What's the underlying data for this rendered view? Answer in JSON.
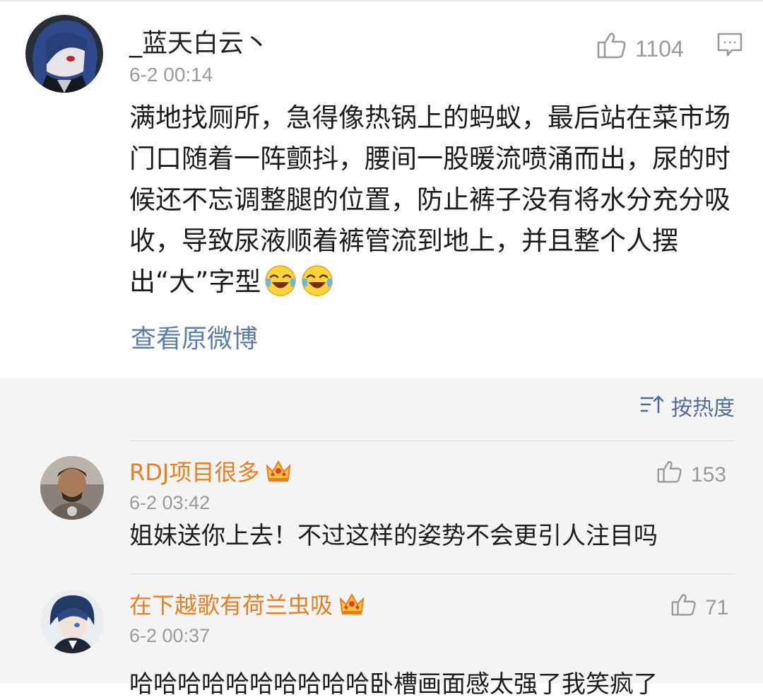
{
  "main_post": {
    "username": "_蓝天白云丶",
    "time": "6-2 00:14",
    "like_count": "1104",
    "like_icon": "thumbs-up-icon",
    "comment_icon": "comment-bubble-icon",
    "text": "满地找厕所，急得像热锅上的蚂蚁，最后站在菜市场门口随着一阵颤抖，腰间一股暖流喷涌而出，尿的时候还不忘调整腿的位置，防止裤子没有将水分充分吸收，导致尿液顺着裤管流到地上，并且整个人摆出“大”字型",
    "emojis": [
      "laughing-crying-emoji",
      "laughing-crying-emoji"
    ],
    "view_original_label": "查看原微博"
  },
  "sort": {
    "icon": "sort-icon",
    "label": "按热度"
  },
  "comments": [
    {
      "username": "RDJ项目很多",
      "badge": "crown-icon",
      "time": "6-2 03:42",
      "like_count": "153",
      "text": "姐妹送你上去！不过这样的姿势不会更引人注目吗"
    },
    {
      "username": "在下越歌有荷兰虫吸",
      "badge": "crown-icon",
      "time": "6-2 00:37",
      "like_count": "71",
      "text": "哈哈哈哈哈哈哈哈哈哈卧槽画面感太强了我笑疯了"
    }
  ],
  "colors": {
    "username_comment": "#e67e22",
    "link": "#5b7ea8",
    "meta_gray": "#9a9a9a",
    "comments_bg": "#f4f4f4"
  }
}
